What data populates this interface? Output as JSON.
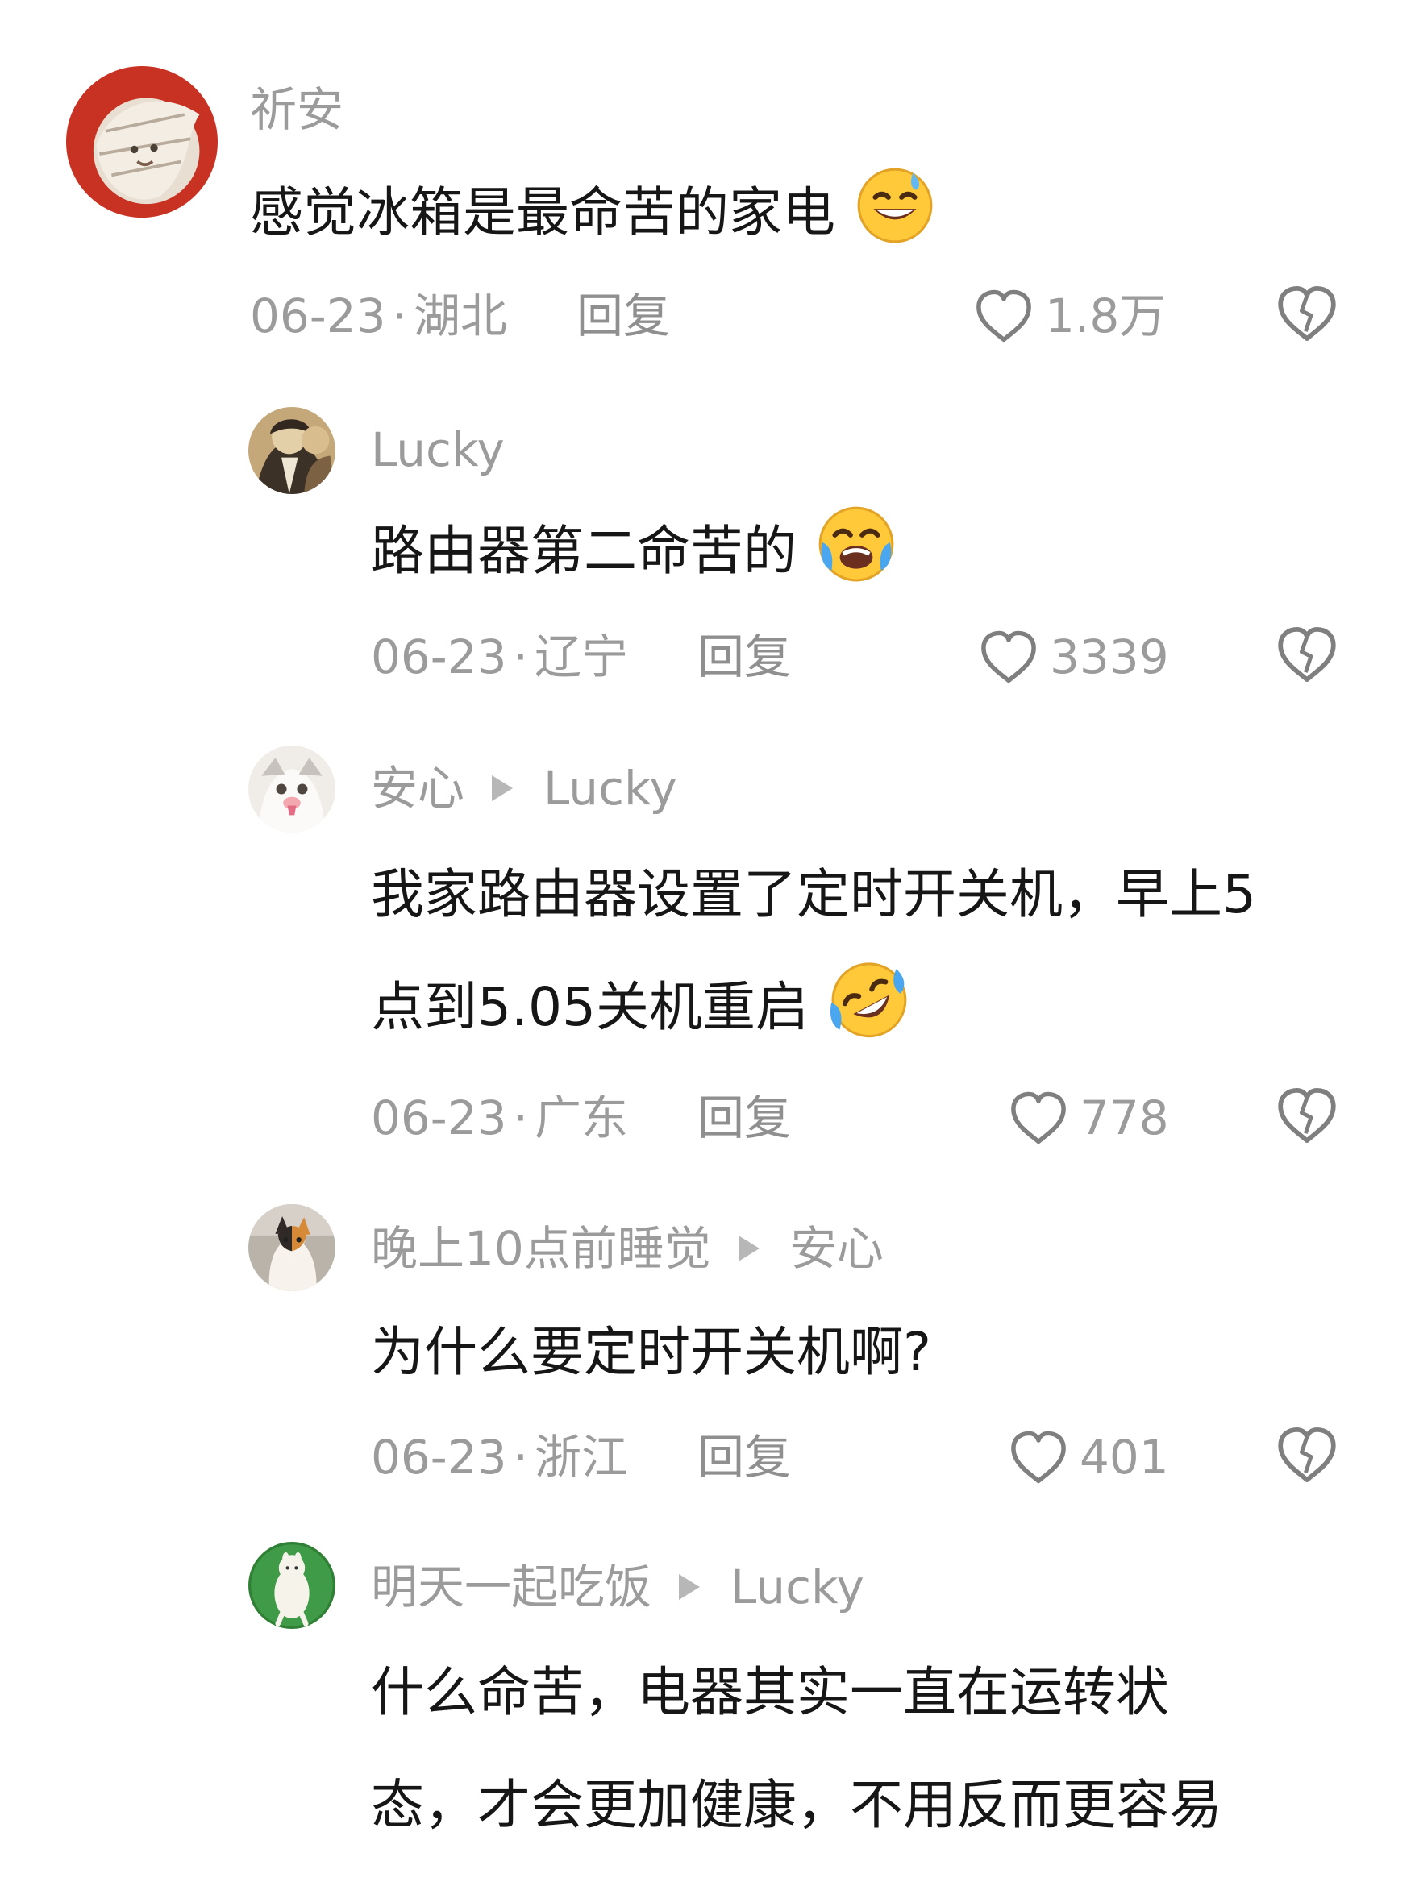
{
  "comments": [
    {
      "username": "祈安",
      "text_lines": [
        "感觉冰箱是最命苦的家电"
      ],
      "emoji": "grinning-sweat-face",
      "date": "06-23",
      "separator": "·",
      "location": "湖北",
      "reply_label": "回复",
      "likes": "1.8万"
    },
    {
      "username": "Lucky",
      "text_lines": [
        "路由器第二命苦的"
      ],
      "emoji": "loudly-crying-face",
      "date": "06-23",
      "separator": "·",
      "location": "辽宁",
      "reply_label": "回复",
      "likes": "3339"
    },
    {
      "username": "安心",
      "reply_to": "Lucky",
      "text_lines": [
        "我家路由器设置了定时开关机，早上5",
        "点到5.05关机重启"
      ],
      "emoji": "rolling-laughing-face",
      "date": "06-23",
      "separator": "·",
      "location": "广东",
      "reply_label": "回复",
      "likes": "778"
    },
    {
      "username": "晚上10点前睡觉",
      "reply_to": "安心",
      "text_lines": [
        "为什么要定时开关机啊?"
      ],
      "date": "06-23",
      "separator": "·",
      "location": "浙江",
      "reply_label": "回复",
      "likes": "401"
    },
    {
      "username": "明天一起吃饭",
      "reply_to": "Lucky",
      "text_lines": [
        "什么命苦，电器其实一直在运转状",
        "态，才会更加健康，不用反而更容易"
      ]
    }
  ],
  "icons": {
    "like": "heart-outline-icon",
    "dislike": "broken-heart-icon",
    "reply_to": "play-arrow-icon"
  },
  "colors": {
    "text": "#161616",
    "secondary": "#9b9b9b",
    "background": "#ffffff"
  }
}
